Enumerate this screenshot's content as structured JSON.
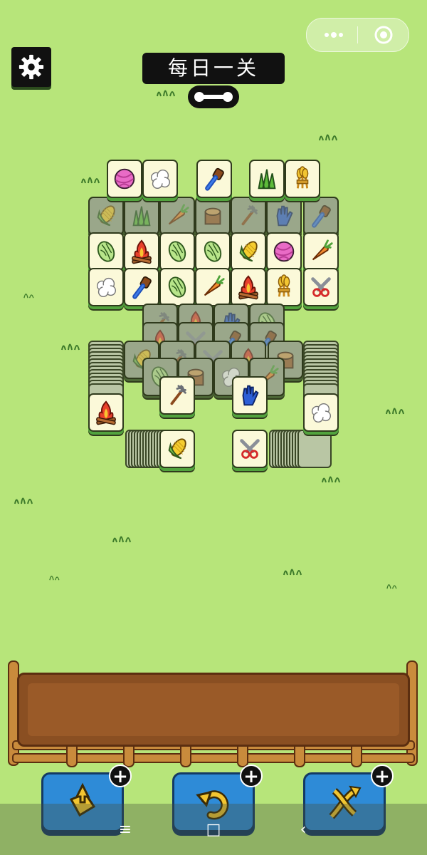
{
  "header": {
    "title": "每日一关"
  },
  "colors": {
    "background": "#b7e57a",
    "tile_face": "#fbf9d9",
    "tile_side": "#52a33e",
    "outline": "#2f3a1c",
    "button_blue": "#2e8bd7",
    "tray_brown": "#8a4f22"
  },
  "icons": {
    "settings": "gear-icon",
    "more": "more-dots-icon",
    "close": "target-close-icon",
    "progress": "bone-progress-icon",
    "nav_menu": "≡",
    "nav_home": "□",
    "nav_back": "‹"
  },
  "board": {
    "visible_tiles": [
      "yarn-icon",
      "cotton-icon",
      "brush-icon",
      "grass-icon",
      "wheat-icon",
      "cabbage-icon",
      "campfire-icon",
      "cabbage-icon",
      "cabbage-icon",
      "corn-icon",
      "yarn-icon",
      "carrot-icon",
      "cotton-icon",
      "brush-icon",
      "cabbage-icon",
      "carrot-icon",
      "campfire-icon",
      "wheat-icon",
      "shears-icon",
      "pitchfork-icon",
      "glove-icon",
      "campfire-icon",
      "cotton-icon",
      "corn-icon",
      "shears-icon"
    ]
  },
  "powerups": [
    {
      "name": "move-out",
      "icon": "tiles-out-icon",
      "plus": "+"
    },
    {
      "name": "undo",
      "icon": "undo-arrow-icon",
      "plus": "+"
    },
    {
      "name": "shuffle",
      "icon": "shuffle-icon",
      "plus": "+"
    }
  ]
}
